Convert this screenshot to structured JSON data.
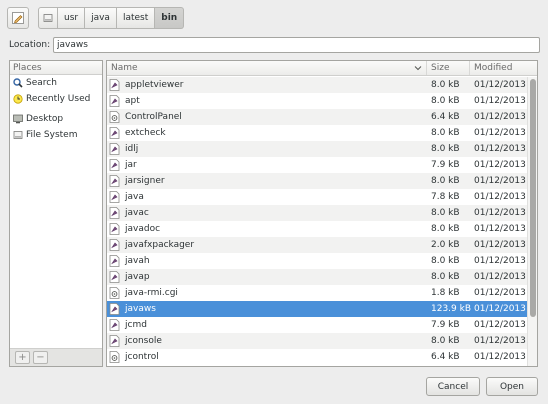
{
  "pathbar": {
    "crumbs": [
      {
        "label": "usr"
      },
      {
        "label": "java"
      },
      {
        "label": "latest"
      },
      {
        "label": "bin",
        "active": true
      }
    ]
  },
  "location": {
    "label": "Location:",
    "value": "javaws"
  },
  "places": {
    "header": "Places",
    "items": [
      {
        "label": "Search",
        "icon": "search-icon"
      },
      {
        "label": "Recently Used",
        "icon": "clock-icon"
      },
      {
        "label": "Desktop",
        "icon": "desktop-icon"
      },
      {
        "label": "File System",
        "icon": "drive-icon"
      }
    ],
    "add_label": "+",
    "remove_label": "−"
  },
  "files": {
    "columns": {
      "name": "Name",
      "size": "Size",
      "modified": "Modified"
    },
    "rows": [
      {
        "name": "appletviewer",
        "size": "8.0 kB",
        "modified": "01/12/2013",
        "icon": "executable-icon"
      },
      {
        "name": "apt",
        "size": "8.0 kB",
        "modified": "01/12/2013",
        "icon": "executable-icon"
      },
      {
        "name": "ControlPanel",
        "size": "6.4 kB",
        "modified": "01/12/2013",
        "icon": "script-icon"
      },
      {
        "name": "extcheck",
        "size": "8.0 kB",
        "modified": "01/12/2013",
        "icon": "executable-icon"
      },
      {
        "name": "idlj",
        "size": "8.0 kB",
        "modified": "01/12/2013",
        "icon": "executable-icon"
      },
      {
        "name": "jar",
        "size": "7.9 kB",
        "modified": "01/12/2013",
        "icon": "executable-icon"
      },
      {
        "name": "jarsigner",
        "size": "8.0 kB",
        "modified": "01/12/2013",
        "icon": "executable-icon"
      },
      {
        "name": "java",
        "size": "7.8 kB",
        "modified": "01/12/2013",
        "icon": "executable-icon"
      },
      {
        "name": "javac",
        "size": "8.0 kB",
        "modified": "01/12/2013",
        "icon": "executable-icon"
      },
      {
        "name": "javadoc",
        "size": "8.0 kB",
        "modified": "01/12/2013",
        "icon": "executable-icon"
      },
      {
        "name": "javafxpackager",
        "size": "2.0 kB",
        "modified": "01/12/2013",
        "icon": "executable-icon"
      },
      {
        "name": "javah",
        "size": "8.0 kB",
        "modified": "01/12/2013",
        "icon": "executable-icon"
      },
      {
        "name": "javap",
        "size": "8.0 kB",
        "modified": "01/12/2013",
        "icon": "executable-icon"
      },
      {
        "name": "java-rmi.cgi",
        "size": "1.8 kB",
        "modified": "01/12/2013",
        "icon": "script-icon"
      },
      {
        "name": "javaws",
        "size": "123.9 kB",
        "modified": "01/12/2013",
        "icon": "executable-icon",
        "selected": true
      },
      {
        "name": "jcmd",
        "size": "7.9 kB",
        "modified": "01/12/2013",
        "icon": "executable-icon"
      },
      {
        "name": "jconsole",
        "size": "8.0 kB",
        "modified": "01/12/2013",
        "icon": "executable-icon"
      },
      {
        "name": "jcontrol",
        "size": "6.4 kB",
        "modified": "01/12/2013",
        "icon": "script-icon"
      }
    ]
  },
  "buttons": {
    "cancel": "Cancel",
    "open": "Open"
  },
  "colors": {
    "selection": "#4a90d9",
    "background": "#ededed"
  }
}
